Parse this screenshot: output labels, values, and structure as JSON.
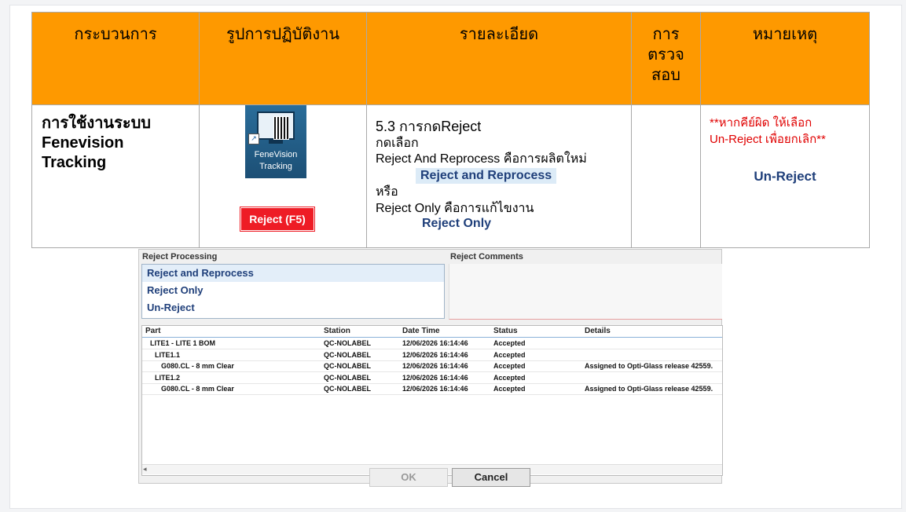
{
  "table": {
    "headers": [
      "กระบวนการ",
      "รูปการปฏิบัติงาน",
      "รายละเอียด",
      "การ\nตรวจ\nสอบ",
      "หมายเหตุ"
    ],
    "process_name": "การใช้งานระบบ\nFenevision\nTracking",
    "app_icon_label": "FeneVision\nTracking",
    "reject_button": "Reject (F5)",
    "detail": {
      "heading": "5.3 การกดReject",
      "line1": "กดเลือก",
      "line2": "Reject And Reprocess คือการผลิตใหม่",
      "option1": "Reject and Reprocess",
      "or": "หรือ",
      "line3": "Reject Only  คือการแก้ไขงาน",
      "option2": "Reject Only"
    },
    "note_text": "**หากคีย์ผิด ให้เลือก\nUn-Reject เพื่อยกเลิก**",
    "note_option": "Un-Reject"
  },
  "dialog": {
    "reject_processing_label": "Reject Processing",
    "reject_comments_label": "Reject Comments",
    "options": [
      "Reject and Reprocess",
      "Reject Only",
      "Un-Reject"
    ],
    "selected_option": "Reject and Reprocess",
    "columns": [
      "Part",
      "Station",
      "Date Time",
      "Status",
      "Details"
    ],
    "rows": [
      {
        "part": "LITE1 - LITE 1 BOM",
        "indent": 0,
        "station": "QC-NOLABEL",
        "datetime": "12/06/2026 16:14:46",
        "status": "Accepted",
        "details": ""
      },
      {
        "part": "LITE1.1",
        "indent": 1,
        "station": "QC-NOLABEL",
        "datetime": "12/06/2026 16:14:46",
        "status": "Accepted",
        "details": ""
      },
      {
        "part": "G080.CL - 8 mm Clear",
        "indent": 2,
        "station": "QC-NOLABEL",
        "datetime": "12/06/2026 16:14:46",
        "status": "Accepted",
        "details": "Assigned to Opti-Glass release 42559."
      },
      {
        "part": "LITE1.2",
        "indent": 1,
        "station": "QC-NOLABEL",
        "datetime": "12/06/2026 16:14:46",
        "status": "Accepted",
        "details": ""
      },
      {
        "part": "G080.CL - 8 mm Clear",
        "indent": 2,
        "station": "QC-NOLABEL",
        "datetime": "12/06/2026 16:14:46",
        "status": "Accepted",
        "details": "Assigned to Opti-Glass release 42559."
      }
    ],
    "ok_label": "OK",
    "cancel_label": "Cancel"
  },
  "colors": {
    "header_bg": "#fe9900",
    "reject_red": "#ee1c25",
    "note_red": "#e00000",
    "option_blue": "#1f3f7a"
  },
  "icons": {
    "app": "fenevision-tracking-icon",
    "scroll_left": "scroll-left-arrow-icon"
  }
}
